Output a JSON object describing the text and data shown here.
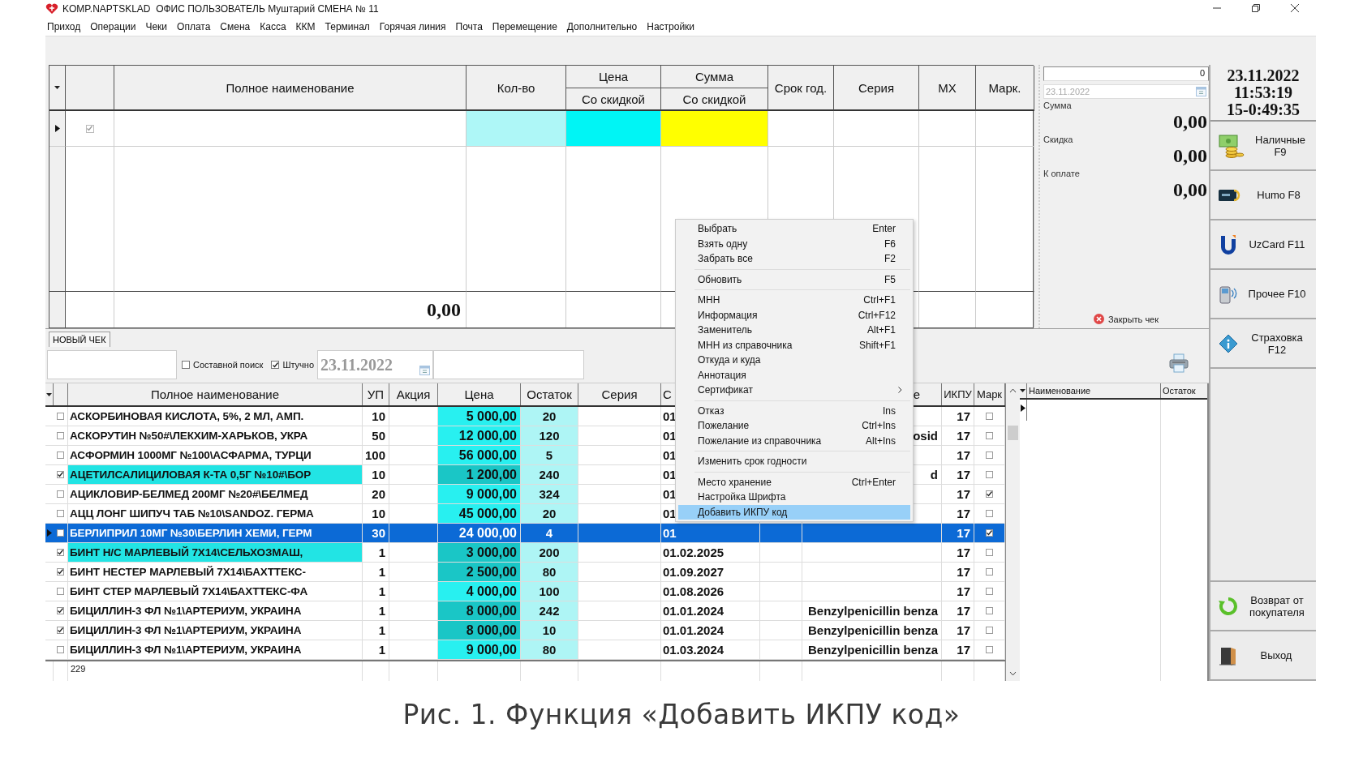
{
  "window": {
    "title": "KOMP.NAPTSKLAD  ОФИС ПОЛЬЗОВАТЕЛЬ Муштарий СМЕНА № 11"
  },
  "menu": [
    "Приход",
    "Операции",
    "Чеки",
    "Оплата",
    "Смена",
    "Касса",
    "ККМ",
    "Терминал",
    "Горячая линия",
    "Почта",
    "Перемещение",
    "Дополнительно",
    "Настройки"
  ],
  "receipt_table": {
    "columns": [
      {
        "label": "Полное наименование"
      },
      {
        "label": "Кол-во"
      },
      {
        "label": "Цена",
        "sublabel": "Со скидкой"
      },
      {
        "label": "Сумма",
        "sublabel": "Со скидкой"
      },
      {
        "label": "Срок год."
      },
      {
        "label": "Серия"
      },
      {
        "label": "МХ"
      },
      {
        "label": "Марк."
      }
    ],
    "entry_checked": true,
    "total": "0,00"
  },
  "summary": {
    "count_field": "0",
    "date_field": "23.11.2022",
    "lines": [
      {
        "label": "Сумма",
        "value": "0,00"
      },
      {
        "label": "Скидка",
        "value": "0,00"
      },
      {
        "label": "К оплате",
        "value": "0,00"
      }
    ],
    "close_button": "Закрыть чек"
  },
  "clock": [
    "23.11.2022",
    "11:53:19",
    "15-0:49:35"
  ],
  "payment_buttons": [
    {
      "label": "Наличные F9",
      "kind": "cash"
    },
    {
      "label": "Humo F8",
      "kind": "humo"
    },
    {
      "label": "UzCard F11",
      "kind": "uzcard"
    },
    {
      "label": "Прочее F10",
      "kind": "phone"
    },
    {
      "label": "Страховка F12",
      "kind": "insurance"
    }
  ],
  "bottom_buttons": [
    {
      "label": "Возврат от покупателя",
      "kind": "return"
    },
    {
      "label": "Выход",
      "kind": "exit"
    }
  ],
  "tabs": [
    {
      "label": "НОВЫЙ ЧЕК",
      "selected": true
    }
  ],
  "search": {
    "options": [
      {
        "label": "Составной поиск",
        "checked": false
      },
      {
        "label": "Штучно",
        "checked": true
      }
    ],
    "date": "23.11.2022"
  },
  "products": {
    "columns": [
      "Полное наименование",
      "УП",
      "Акция",
      "Цена",
      "Остаток",
      "Серия",
      "С",
      "е",
      "ИКПУ",
      "Марк"
    ],
    "rows": [
      {
        "checked": false,
        "highlighted": false,
        "selected": false,
        "name": "АСКОРБИНОВАЯ КИСЛОТА, 5%, 2 МЛ, АМП.",
        "up": "10",
        "price": "5 000,00",
        "stock": "20",
        "column_7": "01",
        "ikpu": "17",
        "marked": false
      },
      {
        "checked": false,
        "highlighted": false,
        "selected": false,
        "name": "АСКОРУТИН №50#\\ЛЕКХИМ-ХАРЬКОВ, УКРА",
        "up": "50",
        "price": "12 000,00",
        "stock": "120",
        "column_7": "01",
        "column_9": "osid",
        "ikpu": "17",
        "marked": false
      },
      {
        "checked": false,
        "highlighted": false,
        "selected": false,
        "name": "АСФОРМИН 1000МГ №100\\АСФАРМА, ТУРЦИ",
        "up": "100",
        "price": "56 000,00",
        "stock": "5",
        "column_7": "01",
        "ikpu": "17",
        "marked": false
      },
      {
        "checked": true,
        "highlighted": true,
        "selected": false,
        "name": "АЦЕТИЛСАЛИЦИЛОВАЯ К-ТА 0,5Г №10#\\БОР",
        "up": "10",
        "price": "1 200,00",
        "stock": "240",
        "column_7": "01",
        "column_9": "d",
        "ikpu": "17",
        "marked": false
      },
      {
        "checked": false,
        "highlighted": false,
        "selected": false,
        "name": "АЦИКЛОВИР-БЕЛМЕД 200МГ №20#\\БЕЛМЕД",
        "up": "20",
        "price": "9 000,00",
        "stock": "324",
        "column_7": "01",
        "ikpu": "17",
        "marked": true
      },
      {
        "checked": false,
        "highlighted": false,
        "selected": false,
        "name": "АЦЦ ЛОНГ ШИПУЧ ТАБ №10\\SANDOZ. ГЕРМА",
        "up": "10",
        "price": "45 000,00",
        "stock": "20",
        "column_7": "01",
        "ikpu": "17",
        "marked": false
      },
      {
        "checked": false,
        "highlighted": false,
        "selected": true,
        "name": "БЕРЛИПРИЛ 10МГ №30\\БЕРЛИН ХЕМИ, ГЕРМ",
        "up": "30",
        "price": "24 000,00",
        "stock": "4",
        "column_7": "01",
        "ikpu": "17",
        "marked": true
      },
      {
        "checked": true,
        "highlighted": true,
        "selected": false,
        "name": "БИНТ Н/С МАРЛЕВЫЙ 7Х14\\СЕЛЬХОЗМАШ,",
        "up": "1",
        "price": "3 000,00",
        "stock": "200",
        "column_7": "01.02.2025",
        "ikpu": "17",
        "marked": false
      },
      {
        "checked": true,
        "highlighted": false,
        "selected": false,
        "name": "БИНТ НЕСТЕР МАРЛЕВЫЙ 7Х14\\БАХТТЕКС-",
        "up": "1",
        "price": "2 500,00",
        "stock": "80",
        "column_7": "01.09.2027",
        "ikpu": "17",
        "marked": false
      },
      {
        "checked": false,
        "highlighted": false,
        "selected": false,
        "name": "БИНТ СТЕР МАРЛЕВЫЙ 7Х14\\БАХТТЕКС-ФА",
        "up": "1",
        "price": "4 000,00",
        "stock": "100",
        "column_7": "01.08.2026",
        "ikpu": "17",
        "marked": false
      },
      {
        "checked": true,
        "highlighted": false,
        "selected": false,
        "name": "БИЦИЛЛИН-3 ФЛ №1\\АРТЕРИУМ, УКРАИНА",
        "up": "1",
        "price": "8 000,00",
        "stock": "242",
        "column_7": "01.01.2024",
        "column_9": "Benzylpenicillin benza",
        "ikpu": "17",
        "marked": false
      },
      {
        "checked": true,
        "highlighted": false,
        "selected": false,
        "name": "БИЦИЛЛИН-3 ФЛ №1\\АРТЕРИУМ, УКРАИНА",
        "up": "1",
        "price": "8 000,00",
        "stock": "10",
        "column_7": "01.01.2024",
        "column_9": "Benzylpenicillin benza",
        "ikpu": "17",
        "marked": false
      },
      {
        "checked": false,
        "highlighted": false,
        "selected": false,
        "name": "БИЦИЛЛИН-3 ФЛ №1\\АРТЕРИУМ, УКРАИНА",
        "up": "1",
        "price": "9 000,00",
        "stock": "80",
        "column_7": "01.03.2024",
        "column_9": "Benzylpenicillin benza",
        "ikpu": "17",
        "marked": false
      }
    ],
    "footer": "229"
  },
  "side_table": {
    "columns": [
      "Наименование",
      "Остаток"
    ]
  },
  "context_menu": {
    "groups": [
      [
        {
          "label": "Выбрать",
          "shortcut": "Enter",
          "submenu": false,
          "selected": false
        },
        {
          "label": "Взять одну",
          "shortcut": "F6",
          "submenu": false,
          "selected": false
        },
        {
          "label": "Забрать все",
          "shortcut": "F2",
          "submenu": false,
          "selected": false
        }
      ],
      [
        {
          "label": "Обновить",
          "shortcut": "F5",
          "submenu": false,
          "selected": false
        }
      ],
      [
        {
          "label": "МНН",
          "shortcut": "Ctrl+F1",
          "submenu": false,
          "selected": false
        },
        {
          "label": "Информация",
          "shortcut": "Ctrl+F12",
          "submenu": false,
          "selected": false
        },
        {
          "label": "Заменитель",
          "shortcut": "Alt+F1",
          "submenu": false,
          "selected": false
        },
        {
          "label": "МНН из справочника",
          "shortcut": "Shift+F1",
          "submenu": false,
          "selected": false
        },
        {
          "label": "Откуда и куда",
          "submenu": false,
          "selected": false
        },
        {
          "label": "Аннотация",
          "submenu": false,
          "selected": false
        },
        {
          "label": "Сертификат",
          "submenu": true,
          "selected": false
        }
      ],
      [
        {
          "label": "Отказ",
          "shortcut": "Ins",
          "submenu": false,
          "selected": false
        },
        {
          "label": "Пожелание",
          "shortcut": "Ctrl+Ins",
          "submenu": false,
          "selected": false
        },
        {
          "label": "Пожелание из справочника",
          "shortcut": "Alt+Ins",
          "submenu": false,
          "selected": false
        }
      ],
      [
        {
          "label": "Изменить срок годности",
          "submenu": false,
          "selected": false
        }
      ],
      [
        {
          "label": "Место хранение",
          "shortcut": "Ctrl+Enter",
          "submenu": false,
          "selected": false
        },
        {
          "label": "Настройка Шрифта",
          "submenu": false,
          "selected": false
        },
        {
          "label": "Добавить ИКПУ код",
          "submenu": false,
          "selected": true
        }
      ]
    ]
  },
  "caption": "Рис. 1. Функция «Добавить ИКПУ код»"
}
